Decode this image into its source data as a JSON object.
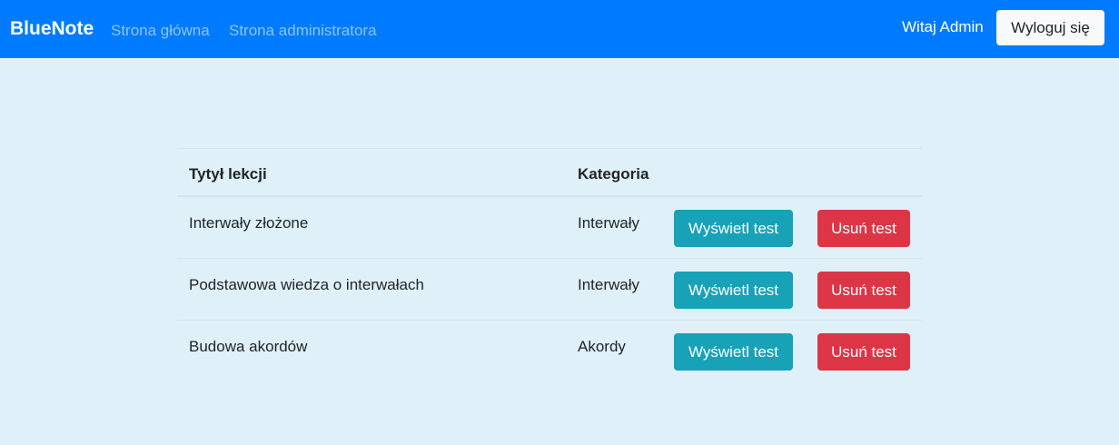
{
  "navbar": {
    "brand": "BlueNote",
    "links": [
      {
        "label": "Strona główna"
      },
      {
        "label": "Strona administratora"
      }
    ],
    "greeting": "Witaj Admin",
    "logout_label": "Wyloguj się"
  },
  "table": {
    "headers": {
      "title": "Tytył lekcji",
      "category": "Kategoria"
    },
    "rows": [
      {
        "title": "Interwały złożone",
        "category": "Interwały",
        "view_label": "Wyświetl test",
        "delete_label": "Usuń test"
      },
      {
        "title": "Podstawowa wiedza o interwałach",
        "category": "Interwały",
        "view_label": "Wyświetl test",
        "delete_label": "Usuń test"
      },
      {
        "title": "Budowa akordów",
        "category": "Akordy",
        "view_label": "Wyświetl test",
        "delete_label": "Usuń test"
      }
    ]
  },
  "colors": {
    "navbar": "#007bff",
    "background": "#dff0f9",
    "view_button": "#17a2b8",
    "delete_button": "#dc3545",
    "logout_button": "#f8f9fa"
  }
}
